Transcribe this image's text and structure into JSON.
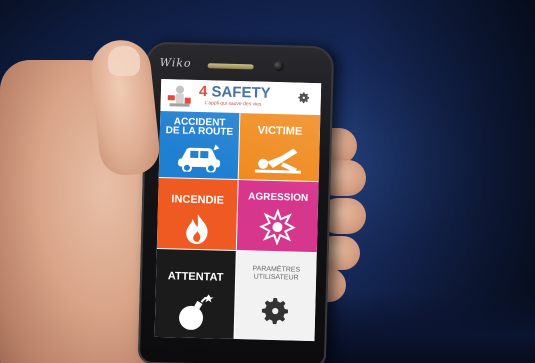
{
  "phone": {
    "brand": "Wiko"
  },
  "app": {
    "title_number": "4",
    "title_word": "SAFETY",
    "tagline": "L'appli qui sauve des vies",
    "settings_icon": "gear-icon"
  },
  "tiles": [
    {
      "id": "accident",
      "label_line1": "ACCIDENT",
      "label_line2": "DE LA ROUTE",
      "icon": "car-crash-icon",
      "color": "#1f7fd1"
    },
    {
      "id": "victime",
      "label_line1": "VICTIME",
      "icon": "injured-person-icon",
      "color": "#f08a1e"
    },
    {
      "id": "incendie",
      "label_line1": "INCENDIE",
      "icon": "flame-icon",
      "color": "#ef5a22"
    },
    {
      "id": "agression",
      "label_line1": "AGRESSION",
      "icon": "fist-fight-icon",
      "color": "#d7368d"
    },
    {
      "id": "attentat",
      "label_line1": "ATTENTAT",
      "icon": "bomb-icon",
      "color": "#1b1b1b"
    },
    {
      "id": "parametres",
      "label_line1": "PARAMÈTRES",
      "label_line2": "UTILISATEUR",
      "icon": "gear-icon",
      "color": "#f2f2f2"
    }
  ]
}
